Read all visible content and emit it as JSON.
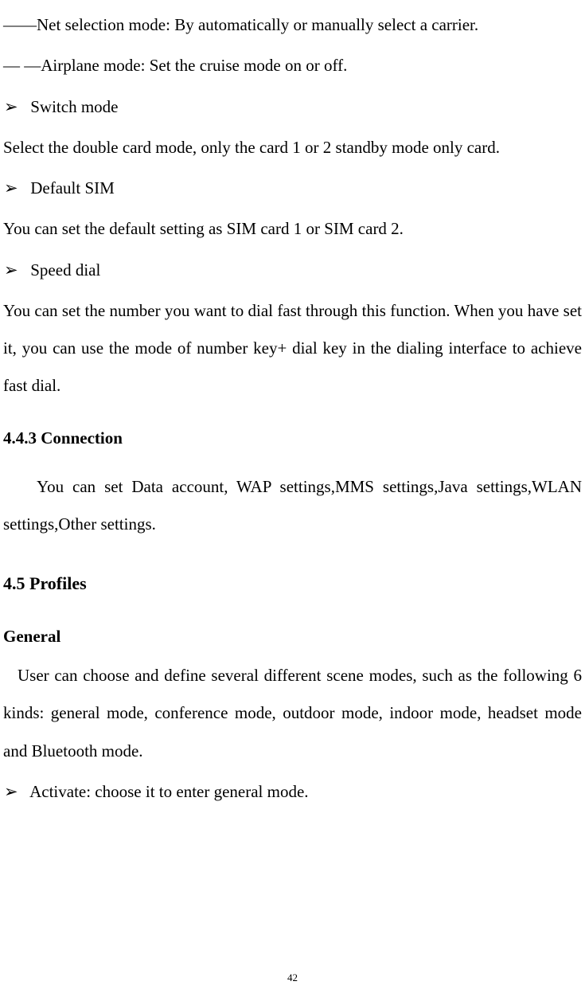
{
  "items": {
    "net_selection": "——Net selection mode: By automatically or manually select a carrier.",
    "airplane_mode": "— —Airplane mode: Set the cruise mode on or off.",
    "switch_mode_title": "Switch mode",
    "switch_mode_body": "Select the double card mode, only the card 1 or 2 standby mode only card.",
    "default_sim_title": "Default SIM",
    "default_sim_body": "You can set the default setting as SIM card 1 or SIM card 2.",
    "speed_dial_title": "Speed dial",
    "speed_dial_body": "You can set the number you want to dial fast through this function. When you have set it, you can use the mode of number key+ dial key in the dialing interface to achieve fast dial.",
    "connection_heading": "4.4.3 Connection",
    "connection_body": "You can set Data account, WAP settings,MMS settings,Java settings,WLAN settings,Other settings.",
    "profiles_heading": "4.5 Profiles",
    "general_heading": "General",
    "general_body": "User can choose and define several different scene modes, such as the following 6 kinds: general mode, conference mode, outdoor mode, indoor mode, headset mode and Bluetooth mode.",
    "activate_item": "Activate: choose it to enter general mode."
  },
  "bullet_glyph": "➢",
  "page_number": "42"
}
